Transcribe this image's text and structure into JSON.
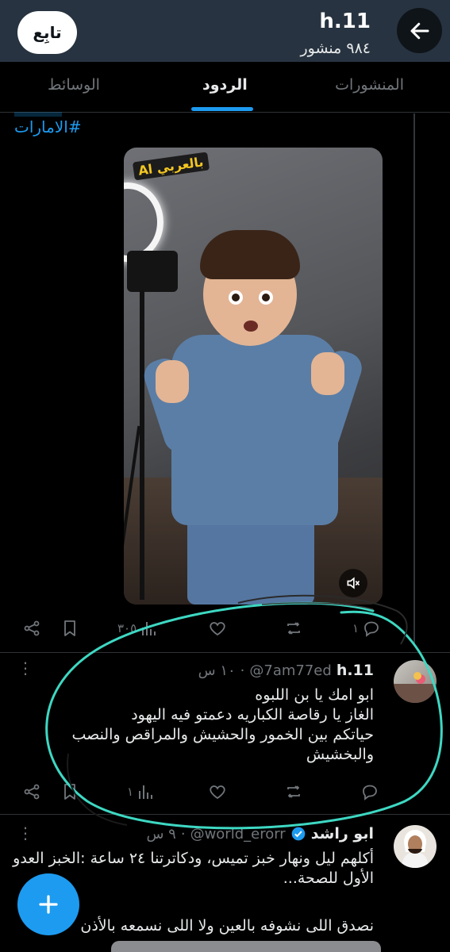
{
  "header": {
    "title": "h.11",
    "subtitle": "٩٨٤ منشور",
    "follow_label": "تابِع",
    "back_icon": "arrow-left-icon"
  },
  "tabs": [
    {
      "label": "المنشورات",
      "active": false
    },
    {
      "label": "الردود",
      "active": true
    },
    {
      "label": "الوسائط",
      "active": false
    }
  ],
  "post": {
    "hashtag": "#الامارات",
    "media_badge": "Al بالعربي",
    "stats": {
      "views": "٣٠٥",
      "replies": "١",
      "retweets": "",
      "likes": ""
    }
  },
  "reply": {
    "name": "h.11",
    "handle": "@7am77ed",
    "time": "١٠ س",
    "lines": [
      "ابو امك يا بن اللبوه",
      "الغاز يا رقاصة الكباريه  دعمتو فيه اليهود",
      "حياتكم بين الخمور والحشيش والمراقص والنصب",
      "والبخشيش"
    ],
    "stats": {
      "views": "١",
      "replies": "",
      "retweets": "",
      "likes": ""
    }
  },
  "next_tweet": {
    "name": "ابو راشد",
    "handle": "@world_erorr",
    "time": "٩ س",
    "lines": [
      "أكلهم ليل ونهار خبز تميس، ودكاترتنا ٢٤ ساعة :الخبز العدو",
      "الأول للصحة..."
    ],
    "extra": "نصدق اللى نشوفه بالعين ولا اللى نسمعه بالأذن"
  },
  "colors": {
    "accent": "#1d9bf0",
    "header_bg": "#273340",
    "annotation": "#3ed8c3"
  },
  "fab_icon": "plus-icon"
}
